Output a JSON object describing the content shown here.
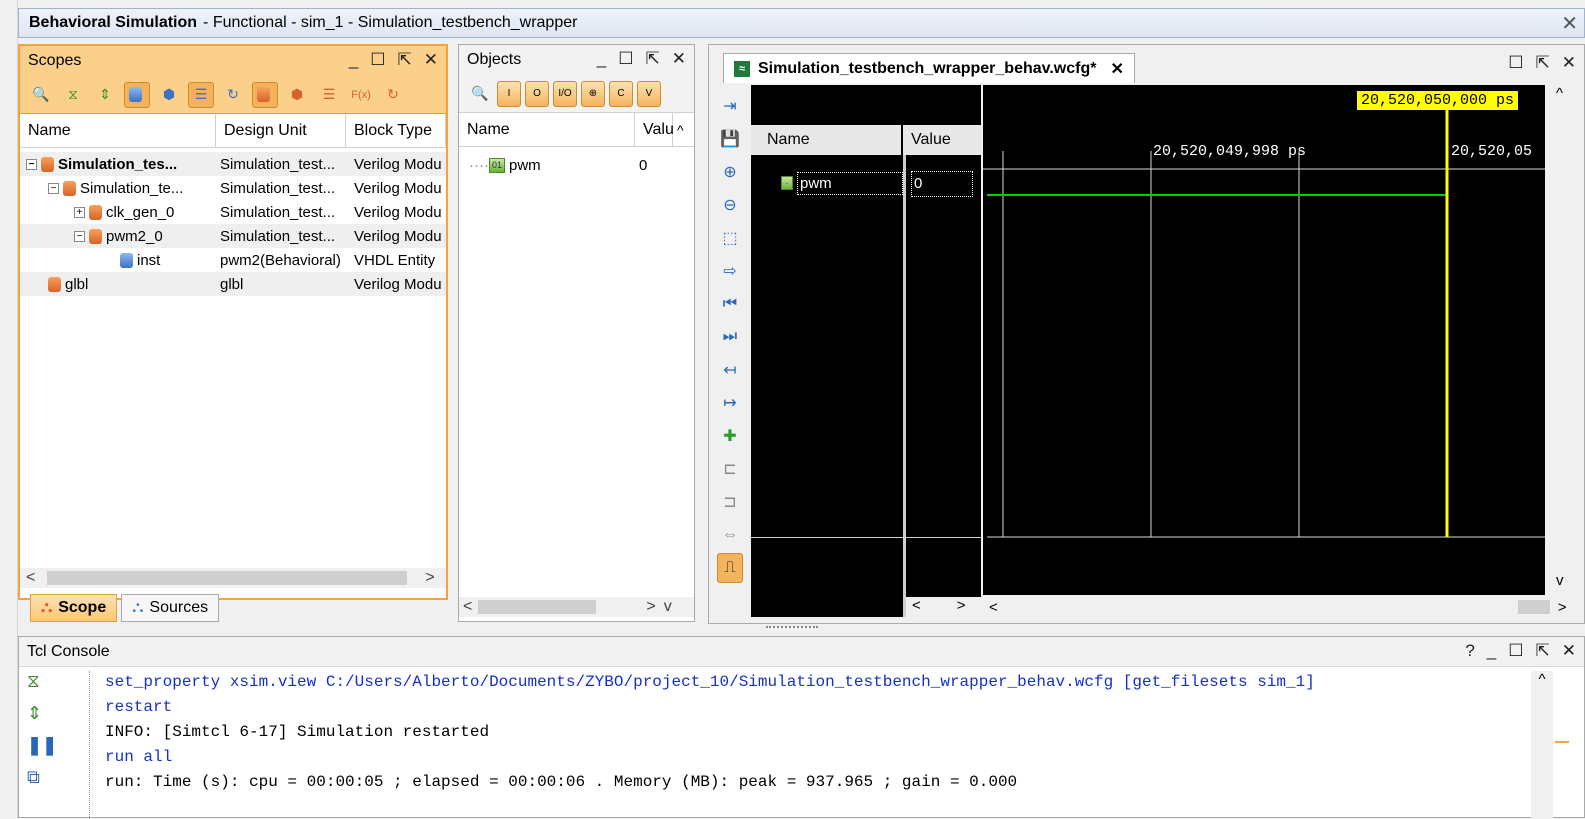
{
  "window": {
    "title_bold": "Behavioral Simulation",
    "title_rest": "- Functional - sim_1 - Simulation_testbench_wrapper",
    "close": "✕"
  },
  "scopes": {
    "title": "Scopes",
    "columns": [
      "Name",
      "Design Unit",
      "Block Type"
    ],
    "rows": [
      {
        "name": "Simulation_tes...",
        "unit": "Simulation_test...",
        "type": "Verilog Modu"
      },
      {
        "name": "Simulation_te...",
        "unit": "Simulation_test...",
        "type": "Verilog Modu"
      },
      {
        "name": "clk_gen_0",
        "unit": "Simulation_test...",
        "type": "Verilog Modu"
      },
      {
        "name": "pwm2_0",
        "unit": "Simulation_test...",
        "type": "Verilog Modu"
      },
      {
        "name": "inst",
        "unit": "pwm2(Behavioral)",
        "type": "VHDL Entity"
      },
      {
        "name": "glbl",
        "unit": "glbl",
        "type": "Verilog Modu"
      }
    ],
    "tabs": [
      "Scope",
      "Sources"
    ]
  },
  "objects": {
    "title": "Objects",
    "columns": [
      "Name",
      "Valu"
    ],
    "rows": [
      {
        "name": "pwm",
        "value": "0"
      }
    ]
  },
  "wave": {
    "tab_title": "Simulation_testbench_wrapper_behav.wcfg*",
    "col_name": "Name",
    "col_value": "Value",
    "signal": {
      "name": "pwm",
      "value": "0"
    },
    "cursor_time": "20,520,050,000 ps",
    "tick1": "20,520,049,998 ps",
    "tick2": "20,520,05"
  },
  "tcl": {
    "title": "Tcl Console",
    "help": "?",
    "lines": [
      "set_property xsim.view C:/Users/Alberto/Documents/ZYBO/project_10/Simulation_testbench_wrapper_behav.wcfg [get_filesets sim_1]",
      "restart",
      "INFO: [Simtcl 6-17] Simulation restarted",
      "run all",
      "run: Time (s): cpu = 00:00:05 ; elapsed = 00:00:06 . Memory (MB): peak = 937.965 ; gain = 0.000"
    ]
  },
  "colors": {
    "accent": "#fbd08a",
    "cursor": "#ffff00",
    "wave": "#00cc00",
    "tcl_blue": "#1530c8"
  }
}
